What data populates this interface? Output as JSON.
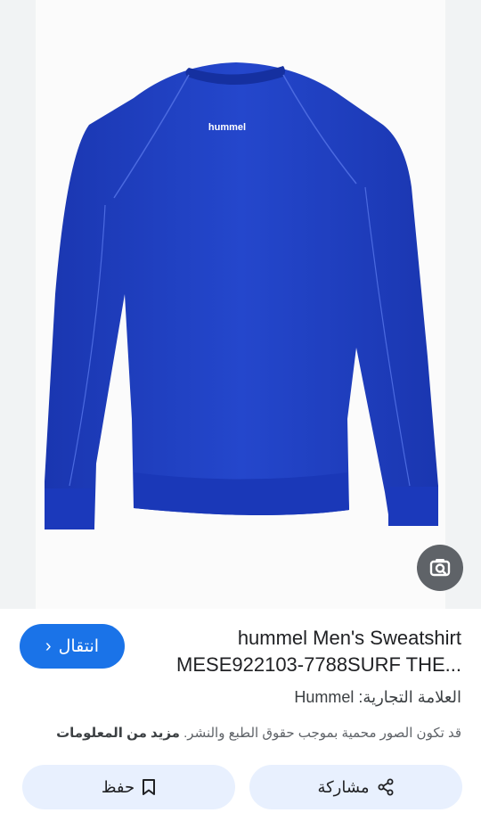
{
  "product": {
    "title_line1": "hummel Men's Sweatshirt",
    "title_line2": "MESE922103-7788SURF THE...",
    "logo_text": "hummel"
  },
  "visit_button": {
    "label": "انتقال",
    "icon": "chevron-right-icon"
  },
  "lens": {
    "icon": "lens-search-icon"
  },
  "brand": {
    "label": "العلامة التجارية",
    "separator": ":",
    "value": "Hummel"
  },
  "copyright_notice": {
    "text": "قد تكون الصور محمية بموجب حقوق الطبع والنشر.",
    "more_link": "مزيد من المعلومات"
  },
  "actions": {
    "share_label": "مشاركة",
    "share_icon": "share-icon",
    "save_label": "حفظ",
    "save_icon": "bookmark-icon"
  },
  "colors": {
    "accent": "#1a73e8",
    "sweatshirt": "#1f3fc0",
    "action_bg": "#e8f0fe"
  }
}
